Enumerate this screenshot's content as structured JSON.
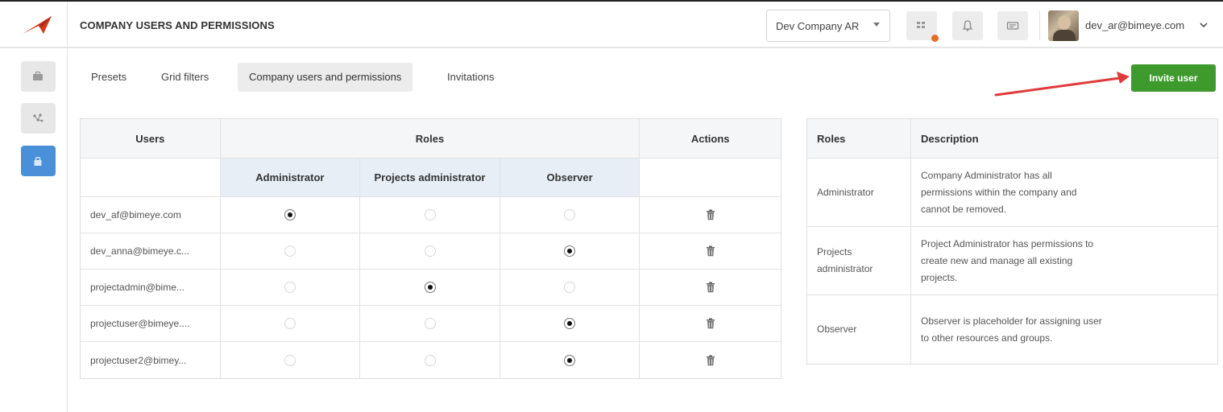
{
  "header": {
    "title": "COMPANY USERS AND PERMISSIONS",
    "company_select": "Dev Company AR",
    "user_email": "dev_ar@bimeye.com"
  },
  "icons": {
    "logo": "paper-plane-logo",
    "apps": "grid-icon",
    "notifications": "bell-icon",
    "messages": "card-icon",
    "sidebar": [
      "briefcase-icon",
      "nodes-icon",
      "lock-icon"
    ]
  },
  "tabs": [
    {
      "label": "Presets",
      "active": false
    },
    {
      "label": "Grid filters",
      "active": false
    },
    {
      "label": "Company users and permissions",
      "active": true
    },
    {
      "label": "Invitations",
      "active": false
    }
  ],
  "invite_button": "Invite user",
  "users_table": {
    "headers": {
      "users": "Users",
      "roles": "Roles",
      "actions": "Actions"
    },
    "role_columns": [
      "Administrator",
      "Projects administrator",
      "Observer"
    ],
    "rows": [
      {
        "user": "dev_af@bimeye.com",
        "role": "Administrator"
      },
      {
        "user": "dev_anna@bimeye.c...",
        "role": "Observer"
      },
      {
        "user": "projectadmin@bime...",
        "role": "Projects administrator"
      },
      {
        "user": "projectuser@bimeye....",
        "role": "Observer"
      },
      {
        "user": "projectuser2@bimey...",
        "role": "Observer"
      }
    ]
  },
  "roles_table": {
    "headers": {
      "roles": "Roles",
      "description": "Description"
    },
    "rows": [
      {
        "role": "Administrator",
        "description": "Company Administrator has all permissions within the company and cannot be removed."
      },
      {
        "role": "Projects administrator",
        "description": "Project Administrator has permissions to create new and manage all existing projects."
      },
      {
        "role": "Observer",
        "description": "Observer is placeholder for assigning user to other resources and groups."
      }
    ]
  },
  "colors": {
    "invite_button": "#3f9a2e",
    "active_sidebar": "#4a90d9",
    "notification_dot": "#e46d2c",
    "logo": "#d63a1f",
    "arrow": "#e03a3a"
  }
}
